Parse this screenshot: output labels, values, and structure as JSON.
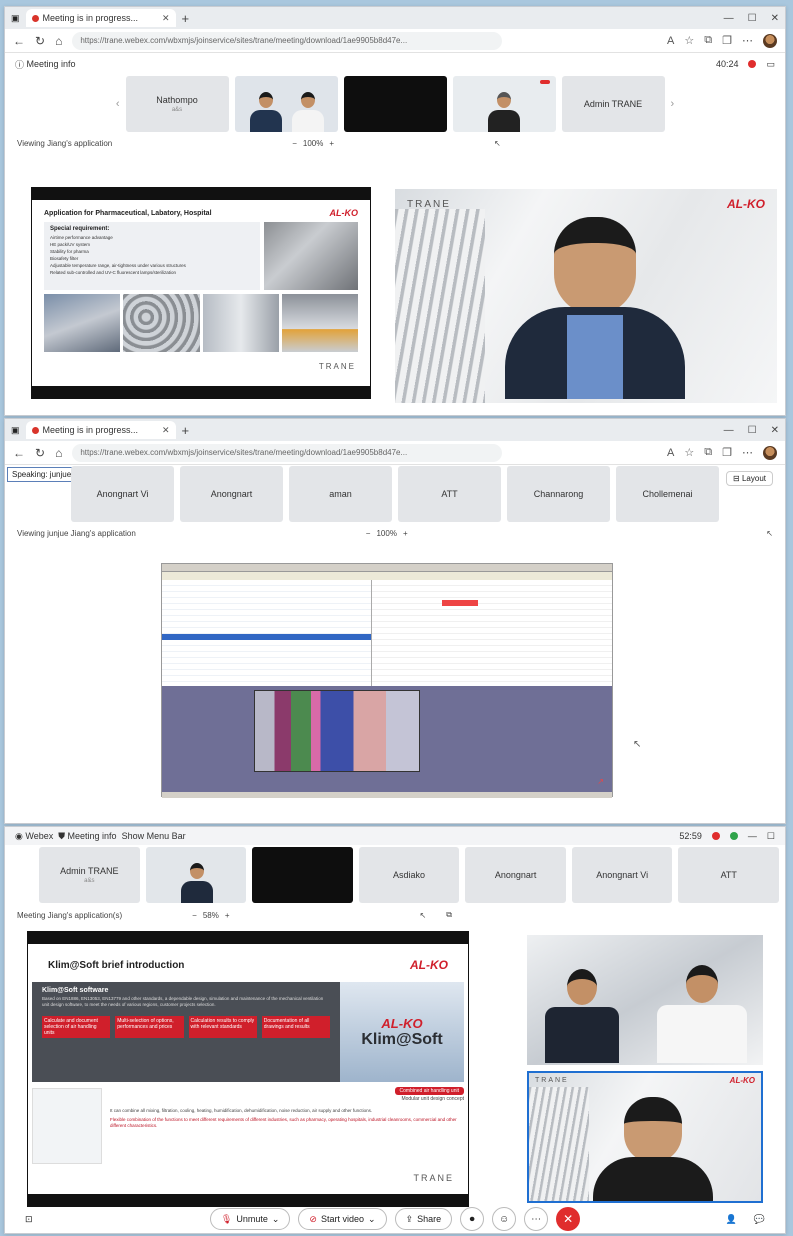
{
  "window1": {
    "tab_title": "Meeting is in progress...",
    "url": "https://trane.webex.com/wbxmjs/joinservice/sites/trane/meeting/download/1ae9905b8d47e...",
    "meeting_info_label": "Meeting info",
    "timer": "40:24",
    "participants": [
      "Nathompo",
      "Admin TRANE"
    ],
    "participant_sub": "a&s",
    "viewing_label": "Viewing Jiang's application",
    "zoom_level": "100%",
    "slide_title": "Application for Pharmaceutical, Labatory, Hospital",
    "slide_heading": "Special requirement:",
    "slide_bullets": [
      "Airtime performance advantage",
      "HE pack/UV system",
      "Stability for pharma",
      "Biosafety filter",
      "Adjustable temperature range, air-tightness under various structures",
      "Related sub-controlled and UV-C fluorescent lamps/sterilization"
    ],
    "brand_alko": "AL-KO",
    "brand_trane": "TRANE"
  },
  "window2": {
    "tab_title": "Meeting is in progress...",
    "url": "https://trane.webex.com/wbxmjs/joinservice/sites/trane/meeting/download/1ae9905b8d47e...",
    "speaking_label": "Speaking: junjue Jiang",
    "layout_label": "Layout",
    "participants": [
      "Anongnart Vi",
      "Anongnart",
      "aman",
      "ATT",
      "Channarong",
      "Chollemenai"
    ],
    "viewing_label": "Viewing junjue Jiang's application",
    "zoom_level": "100%"
  },
  "window3": {
    "menu": [
      "Webex",
      "Meeting info",
      "Show Menu Bar"
    ],
    "timer": "52:59",
    "participants": [
      "Admin TRANE",
      "Asdiako",
      "Anongnart",
      "Anongnart Vi",
      "ATT"
    ],
    "participant_sub": "a&s",
    "viewing_label": "Meeting Jiang's application(s)",
    "zoom_level": "58%",
    "slide_title": "Klim@Soft brief introduction",
    "software_heading": "Klim@Soft software",
    "software_desc": "Based on EN1886, EN13053, EN13779 and other standards, a dependable design, simulation and maintenance of the mechanical ventilation unit design software, to meet the needs of various regions, customer projects selection.",
    "red_items": [
      "Calculate and document selection of air handling units",
      "Multi-selection of options, performances and prices",
      "Calculation results to comply with relevant standards",
      "Documentation of all drawings and results"
    ],
    "logo_text": "Klim@Soft",
    "combined_button": "Combined air handling unit",
    "modular_label": "Modular unit design concept",
    "unit_text": "It can combine all  mixing, filtration, cooling, heating, humidification, dehumidification, noise reduction, air supply and other functions.",
    "flexible_text": "Flexible combination of the functions to meet different requirements of different industries, such as pharmacy, operating hospitals, industrial cleanrooms, commercial and other different characteristics.",
    "brand_alko": "AL-KO",
    "brand_trane": "TRANE",
    "controls": {
      "unmute": "Unmute",
      "start_video": "Start video",
      "share": "Share"
    }
  }
}
